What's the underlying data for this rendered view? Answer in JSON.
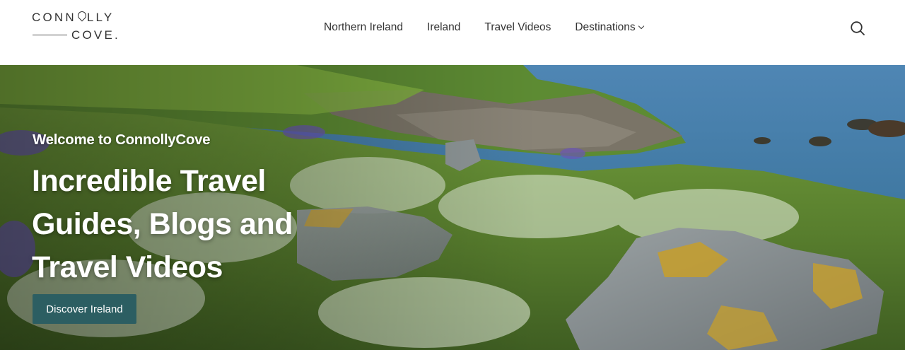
{
  "logo": {
    "line1_before": "CONN",
    "line1_after": "LLY",
    "line2": "COVE."
  },
  "nav": {
    "items": [
      {
        "label": "Northern Ireland"
      },
      {
        "label": "Ireland"
      },
      {
        "label": "Travel Videos"
      },
      {
        "label": "Destinations",
        "has_dropdown": true
      }
    ]
  },
  "search": {
    "icon": "search-icon"
  },
  "hero": {
    "welcome": "Welcome to ConnollyCove",
    "headline_lines": [
      "Incredible Travel",
      "Guides, Blogs and",
      "Travel Videos"
    ],
    "cta_label": "Discover Ireland",
    "cta_color": "#2c5e62",
    "image_description_icon": "coastal-meadow-image"
  }
}
